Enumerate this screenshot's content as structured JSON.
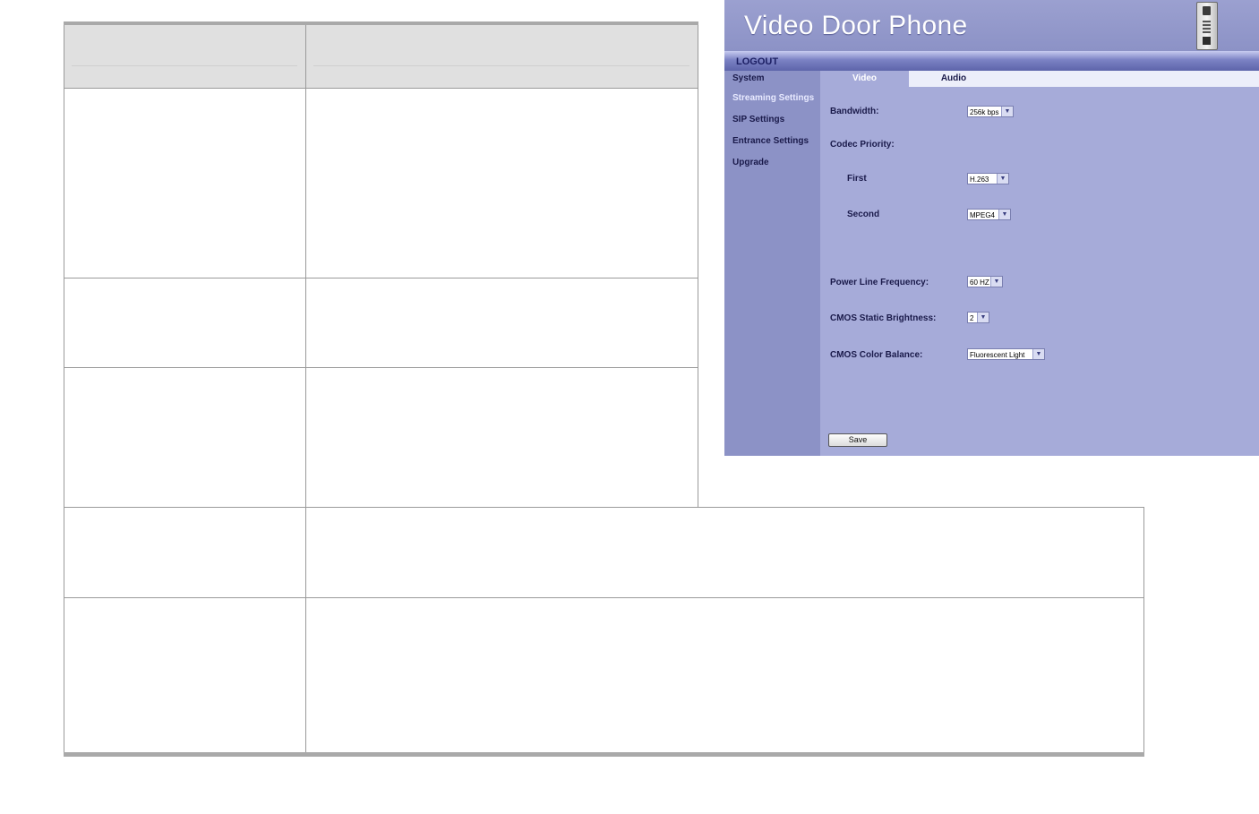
{
  "app": {
    "title": "Video Door Phone",
    "logout_label": "LOGOUT",
    "sidebar": {
      "items": [
        {
          "label": "System",
          "active": false
        },
        {
          "label": "Streaming Settings",
          "active": true
        },
        {
          "label": "SIP Settings",
          "active": false
        },
        {
          "label": "Entrance Settings",
          "active": false
        },
        {
          "label": "Upgrade",
          "active": false
        }
      ]
    },
    "tabs": [
      {
        "label": "Video",
        "selected": true
      },
      {
        "label": "Audio",
        "selected": false
      }
    ],
    "form": {
      "bandwidth_label": "Bandwidth:",
      "bandwidth_value": "256k bps",
      "codec_priority_label": "Codec Priority:",
      "first_label": "First",
      "first_value": "H.263",
      "second_label": "Second",
      "second_value": "MPEG4",
      "power_line_label": "Power Line Frequency:",
      "power_line_value": "60 HZ",
      "brightness_label": "CMOS Static Brightness:",
      "brightness_value": "2",
      "color_balance_label": "CMOS Color Balance:",
      "color_balance_value": "Fluorescent Light",
      "save_label": "Save"
    },
    "colors": {
      "panel": "#a6abd9",
      "sidebar": "#8c92c6",
      "tab_bar": "#eceefa",
      "header_rule": "#a9a9a9"
    }
  }
}
